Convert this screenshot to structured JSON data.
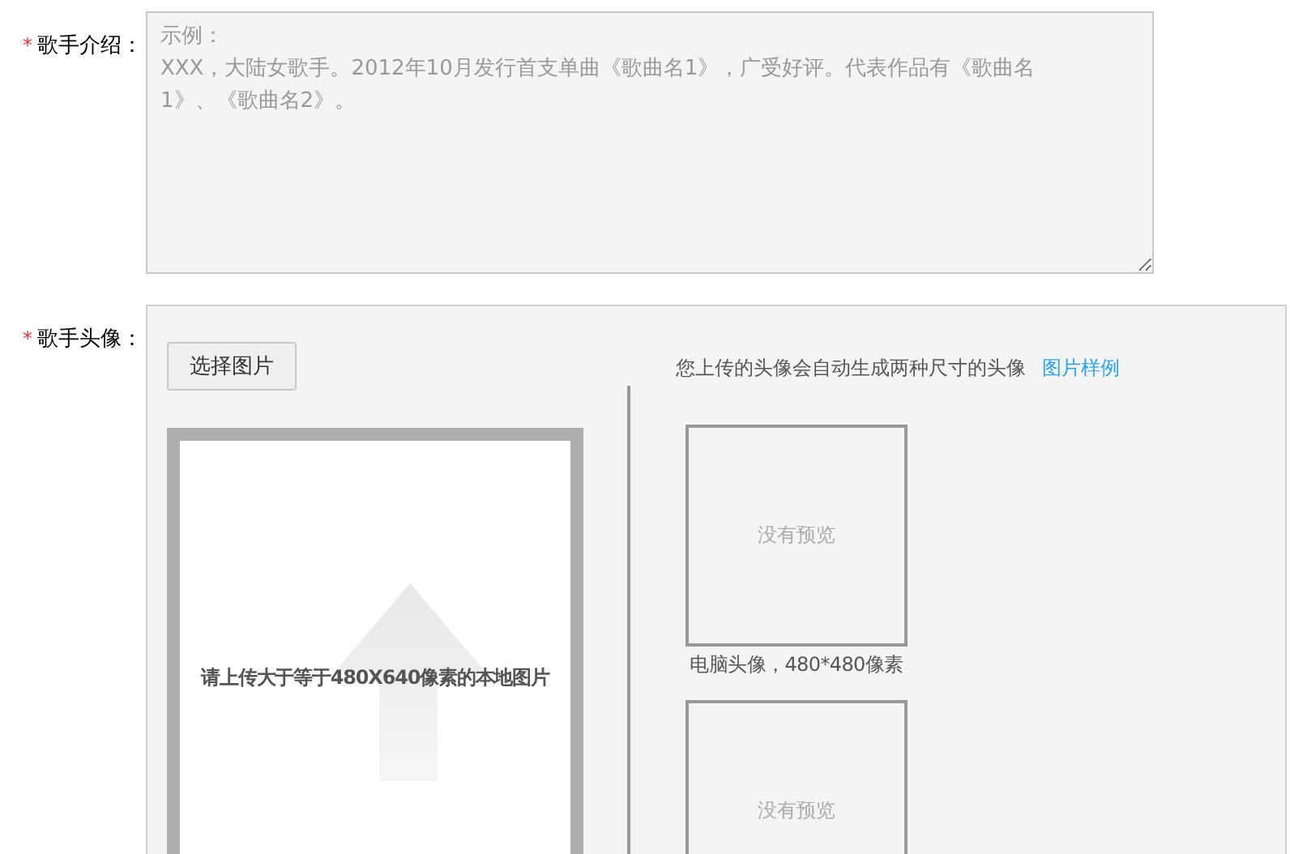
{
  "fields": [
    {
      "kind": "textarea",
      "mark": "*",
      "label": "歌手介绍：",
      "placeholder": "示例：\nXXX，大陆女歌手。2012年10月发行首支单曲《歌曲名1》，广受好评。代表作品有《歌曲名1》、《歌曲名2》。"
    },
    {
      "kind": "avatar",
      "mark": "*",
      "label": "歌手头像：",
      "button": "选择图片",
      "upload_hint": "请上传大于等于480X640像素的本地图片",
      "note": "您上传的头像会自动生成两种尺寸的头像",
      "link": "图片样例",
      "previews": [
        {
          "placeholder": "没有预览",
          "caption": "电脑头像，480*480像素"
        },
        {
          "placeholder": "没有预览"
        }
      ]
    }
  ]
}
